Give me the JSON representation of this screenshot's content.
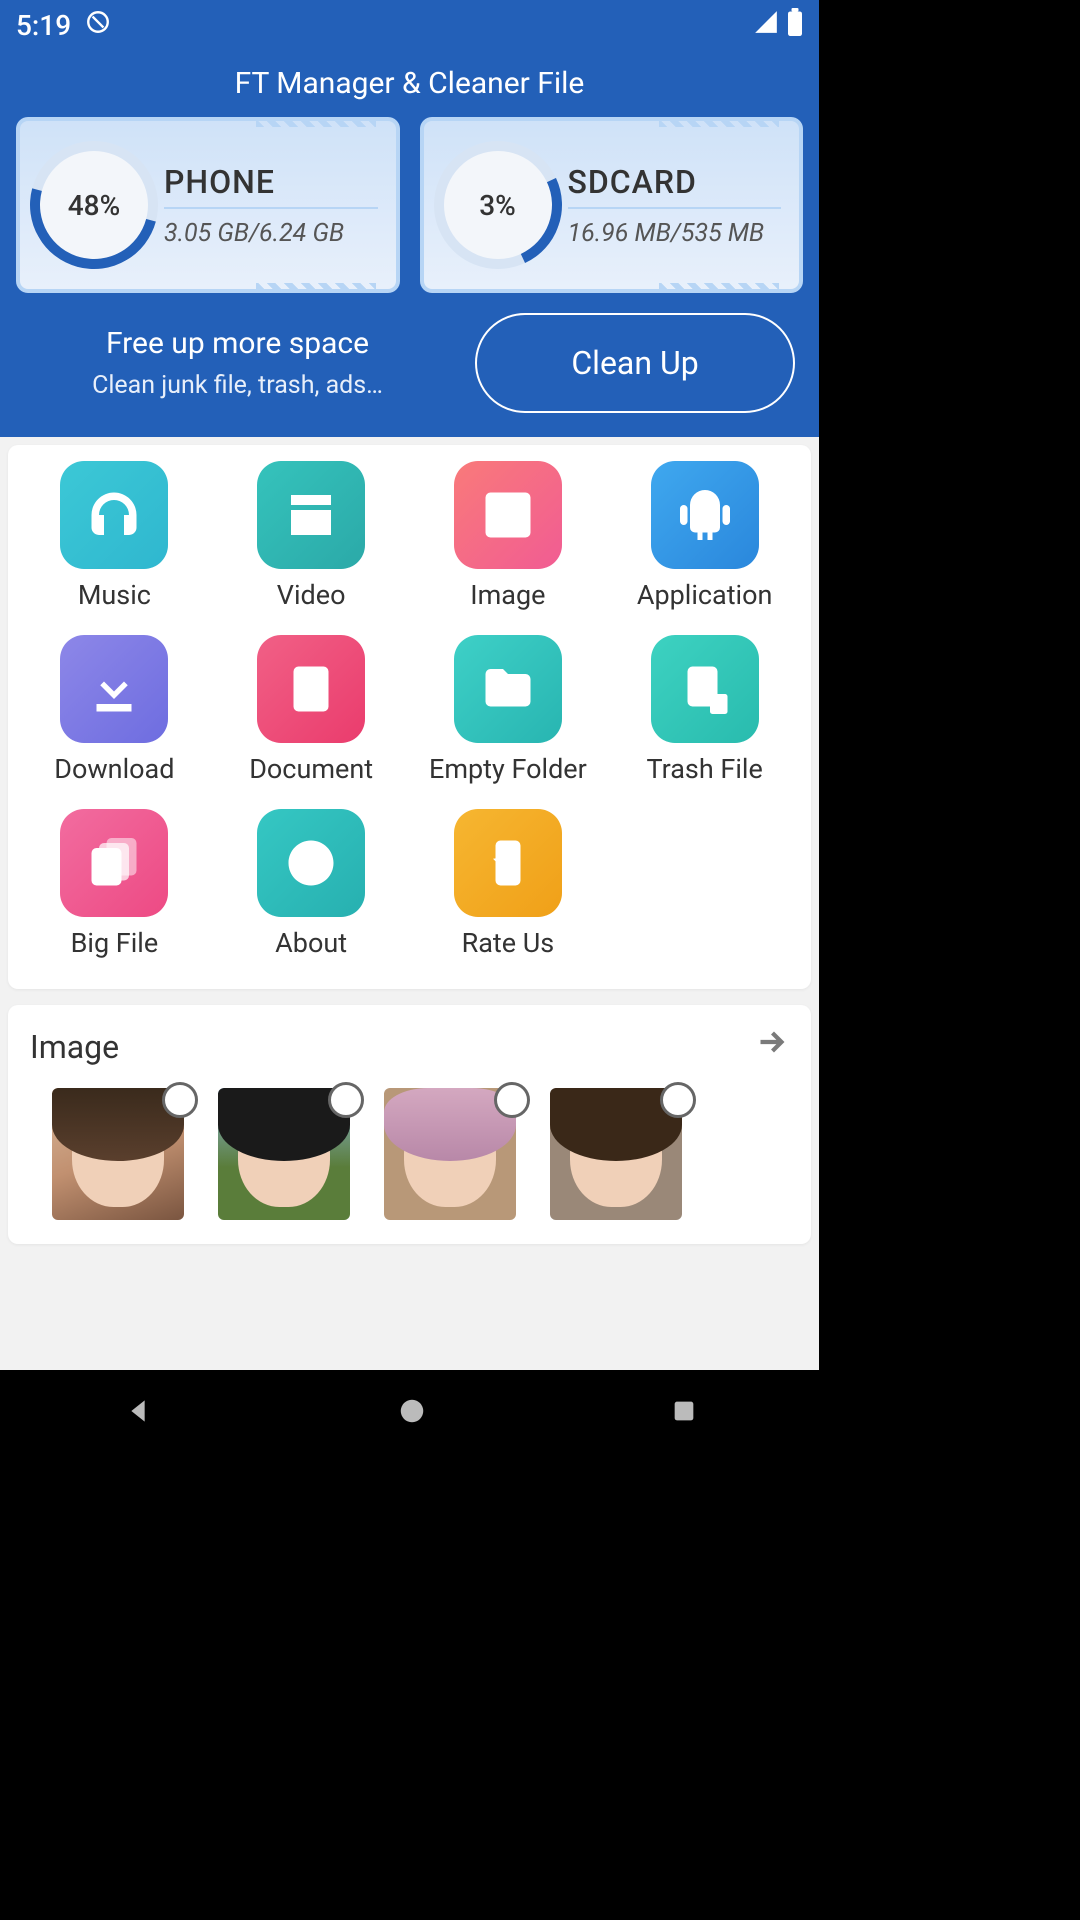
{
  "status": {
    "time": "5:19"
  },
  "app": {
    "title": "FT Manager & Cleaner File"
  },
  "storage": {
    "phone": {
      "name": "PHONE",
      "pct": "48%",
      "size": "3.05 GB/6.24 GB"
    },
    "sdcard": {
      "name": "SDCARD",
      "pct": "3%",
      "size": "16.96 MB/535 MB"
    }
  },
  "cleanup": {
    "title": "Free up more space",
    "sub": "Clean junk file, trash, ads…",
    "button": "Clean Up"
  },
  "categories": [
    {
      "label": "Music",
      "icon": "headphones",
      "cls": "c-music"
    },
    {
      "label": "Video",
      "icon": "clapper",
      "cls": "c-video"
    },
    {
      "label": "Image",
      "icon": "picture",
      "cls": "c-image"
    },
    {
      "label": "Application",
      "icon": "android",
      "cls": "c-app"
    },
    {
      "label": "Download",
      "icon": "download",
      "cls": "c-download"
    },
    {
      "label": "Document",
      "icon": "doc",
      "cls": "c-document"
    },
    {
      "label": "Empty Folder",
      "icon": "folder-search",
      "cls": "c-empty"
    },
    {
      "label": "Trash File",
      "icon": "trash-doc",
      "cls": "c-trash"
    },
    {
      "label": "Big File",
      "icon": "files",
      "cls": "c-big"
    },
    {
      "label": "About",
      "icon": "info",
      "cls": "c-about"
    },
    {
      "label": "Rate Us",
      "icon": "rate",
      "cls": "c-rate"
    }
  ],
  "imageSection": {
    "title": "Image"
  }
}
